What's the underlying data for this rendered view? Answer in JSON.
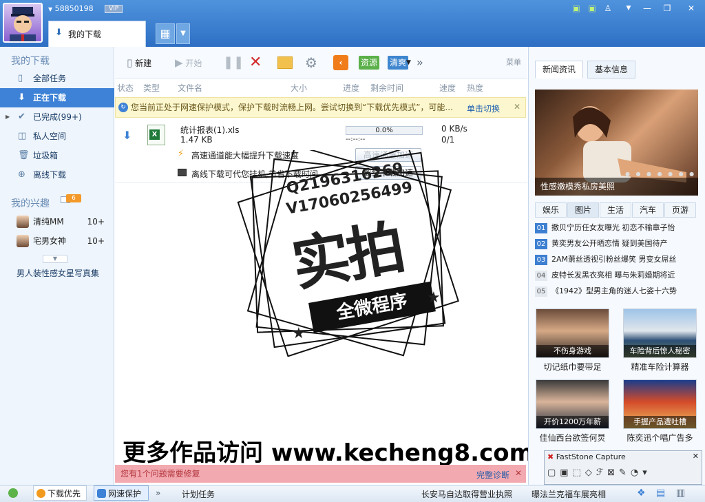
{
  "header": {
    "uid": "58850198",
    "vip": "VIP",
    "tab_title": "我的下载"
  },
  "sidebar": {
    "section1": "我的下载",
    "items": [
      {
        "label": "全部任务",
        "icon": "document-icon"
      },
      {
        "label": "正在下载",
        "icon": "download-arrow-icon"
      },
      {
        "label": "已完成(99+)",
        "icon": "check-icon"
      },
      {
        "label": "私人空间",
        "icon": "private-icon"
      },
      {
        "label": "垃圾箱",
        "icon": "trash-icon"
      },
      {
        "label": "离线下载",
        "icon": "cloud-download-icon"
      }
    ],
    "section2": "我的兴趣",
    "section2_badge": "6",
    "interests": [
      {
        "label": "清纯MM",
        "count": "10+"
      },
      {
        "label": "宅男女神",
        "count": "10+"
      }
    ],
    "promo": "男人装性感女星写真集"
  },
  "toolbar": {
    "new": "新建",
    "start": "开始",
    "resource": "资源",
    "clean": "清爽",
    "menu": "菜单"
  },
  "columns": {
    "status": "状态",
    "type": "类型",
    "filename": "文件名",
    "size": "大小",
    "progress": "进度",
    "remaining": "剩余时间",
    "speed": "速度",
    "heat": "热度"
  },
  "notice": {
    "text": "您当前正处于网速保护模式，保护下载时流畅上网。尝试切换到“下载优先模式”，可能...",
    "action": "单击切换"
  },
  "task": {
    "filename": "统计报表(1).xls",
    "size": "1.47 KB",
    "progress_text": "0.0%",
    "progress": 0,
    "remaining": "--:--:--",
    "speed": "0 KB/s",
    "heat": "0/1",
    "tip1": "高速通道能大幅提升下载速度",
    "tip1_btn": "高速通道加速",
    "tip2": "离线下载可代您挂机,节省下载时间",
    "tip2_btn": "离线下载加速"
  },
  "stamp": {
    "line1": "Q2196316269",
    "line2": "V17060256499",
    "big": "实拍",
    "banner": "全微程序"
  },
  "watermark": "更多作品访问 www.kecheng8.com",
  "bottom_alert": {
    "text": "您有1个问题需要修复",
    "action": "完整诊断"
  },
  "right": {
    "tabs": [
      "新闻资讯",
      "基本信息"
    ],
    "photo_caption": "性感嫩模秀私房美照",
    "cat_tabs": [
      "娱乐",
      "图片",
      "生活",
      "汽车",
      "页游"
    ],
    "news": [
      {
        "n": "01",
        "t": "撒贝宁历任女友曝光 初恋不输章子怡"
      },
      {
        "n": "02",
        "t": "黄奕男友公开晒恋情 疑到美国待产"
      },
      {
        "n": "03",
        "t": "2AM萧丝透视引粉丝爆笑 男变女屌丝"
      },
      {
        "n": "04",
        "t": "皮特长发黑衣亮相 曝与朱莉婚期将近"
      },
      {
        "n": "05",
        "t": "《1942》型男主角的迷人七姿十六势"
      }
    ],
    "thumbs": [
      {
        "cap": "不伤身游戏",
        "sub": "切记纸巾要带足"
      },
      {
        "cap": "车险背后惊人秘密",
        "sub": "精准车险计算器"
      },
      {
        "cap": "开价1200万年薪",
        "sub": "佳仙西台欲签何炅"
      },
      {
        "cap": "手握产品遭吐槽",
        "sub": "陈奕迅个唱广告多"
      }
    ]
  },
  "faststone": {
    "title": "FastStone Capture"
  },
  "statusbar": {
    "mode1": "下载优先",
    "mode2": "网速保护",
    "plan": "计划任务",
    "news1": "长安马自达取得营业执照",
    "news2": "曝法兰克福车展亮相"
  }
}
